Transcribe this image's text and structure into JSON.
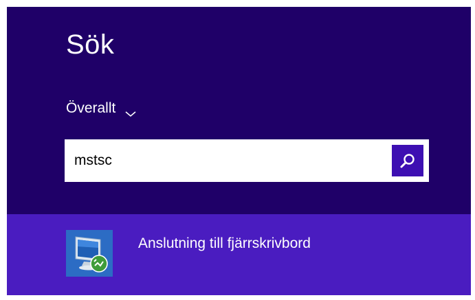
{
  "search_pane": {
    "title": "Sök",
    "scope": {
      "label": "Överallt",
      "icon": "chevron-down-icon"
    },
    "search": {
      "value": "mstsc",
      "button_icon": "search-icon"
    },
    "results": [
      {
        "label": "Anslutning till fjärrskrivbord",
        "icon": "remote-desktop-icon"
      }
    ]
  },
  "colors": {
    "panel_background": "#1f0068",
    "result_highlight": "#4a1cc0",
    "search_button": "#3d0fb2",
    "text": "#ffffff"
  }
}
